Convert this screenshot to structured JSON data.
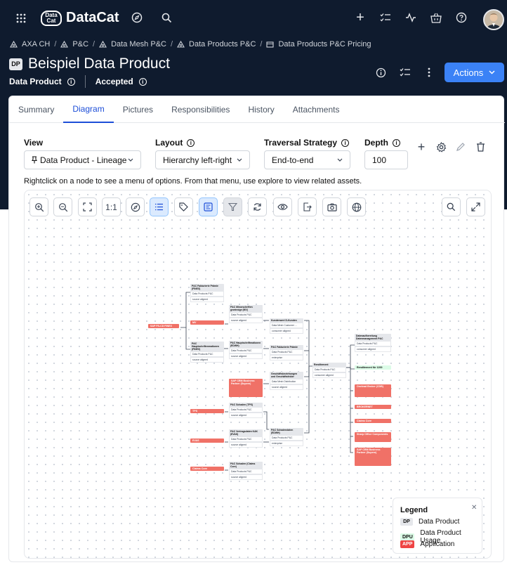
{
  "topbar": {
    "app_name": "DataCat",
    "logo_text": "Data Cat"
  },
  "breadcrumb": [
    "AXA CH",
    "P&C",
    "Data Mesh P&C",
    "Data Products P&C",
    "Data Products P&C Pricing"
  ],
  "asset": {
    "type_badge": "DP",
    "title": "Beispiel Data Product",
    "type_label": "Data Product",
    "status_label": "Accepted"
  },
  "actions_label": "Actions",
  "tabs": [
    {
      "label": "Summary"
    },
    {
      "label": "Diagram"
    },
    {
      "label": "Pictures"
    },
    {
      "label": "Responsibilities"
    },
    {
      "label": "History"
    },
    {
      "label": "Attachments"
    }
  ],
  "filters": {
    "view_label": "View",
    "view_value": "Data Product - Lineage",
    "layout_label": "Layout",
    "layout_value": "Hierarchy left-right",
    "traversal_label": "Traversal Strategy",
    "traversal_value": "End-to-end",
    "depth_label": "Depth",
    "depth_value": "100"
  },
  "hint": "Rightclick on a node to see a menu of options. From that menu, use explore to view related assets.",
  "toolbar": {
    "actual_size": "1:1"
  },
  "nodes": [
    {
      "b": "P&C Fakturierte Prämie (FINEX)",
      "r1": "Data Products P&C",
      "r2": "source aligned"
    },
    {
      "b": "P&C Hauptschriftenmationen (FINEX)",
      "r1": "Data Products P&C",
      "r2": "source aligned"
    },
    {
      "b": "P&C Minorschriften gewinnige (MV)",
      "r1": "Data Products P&C",
      "r2": "source aligned"
    },
    {
      "b": "P&C Hauptschriftmationen (EDWH)",
      "r1": "Data Products P&C",
      "r2": "source aligned"
    },
    {
      "b": "P&C Schaden (TPS)",
      "r1": "Data Products P&C",
      "r2": "source aligned"
    },
    {
      "b": "P&C Vertragsdaten KAK (EVAS)",
      "r1": "Data Products P&C",
      "r2": "source aligned"
    },
    {
      "b": "P&C Schaden (Claims Core)",
      "r1": "Data Products P&C",
      "r2": "source aligned"
    },
    {
      "b": "Kundenwert D-Kunden",
      "r1": "Data Mesh Customer ...",
      "r2": "consumer aligned"
    },
    {
      "b": "P&C Fakturierte Prämie",
      "r1": "Data Products P&C",
      "r2": "enterprise"
    },
    {
      "b": "Geschäftsbeziehungen und Geschäftsfelder",
      "r1": "Data Mesh Distribution",
      "r2": "source aligned"
    },
    {
      "b": "P&C Schadendaten (EDWH)",
      "r1": "Data Products P&C",
      "r2": "enterprise"
    },
    {
      "b": "Renditement",
      "r1": "Data Products P&C",
      "r2": "consumer aligned"
    },
    {
      "b": "Datenaufbereitung Datenmanagement P&C",
      "r1": "Data Products P&C",
      "r2": "consumer aligned"
    }
  ],
  "apps": [
    "SAP FS-CD FINEX",
    "MV",
    "SAP CRM Business Partner (Supern)",
    "TPS",
    "EVAS",
    "Claims Core",
    "Onelead Broker (CDB)",
    "BROKERNET",
    "Claims Core",
    "Sharp Office Components",
    "SAP CRM Business Partner (Supern)"
  ],
  "dpus": [
    "Renditement für 1200"
  ],
  "legend": {
    "title": "Legend",
    "items": [
      {
        "badge": "DP",
        "label": "Data Product"
      },
      {
        "badge": "DPU",
        "label": "Data Product Usage"
      },
      {
        "badge": "APP",
        "label": "Application"
      }
    ]
  },
  "colors": {
    "header_bg": "#0f1b2e",
    "accent": "#1d4ed8",
    "actions": "#3b82f6",
    "app": "#f07167",
    "dpu_bg": "#dcfce7",
    "dp_bg": "#e5e7eb"
  }
}
